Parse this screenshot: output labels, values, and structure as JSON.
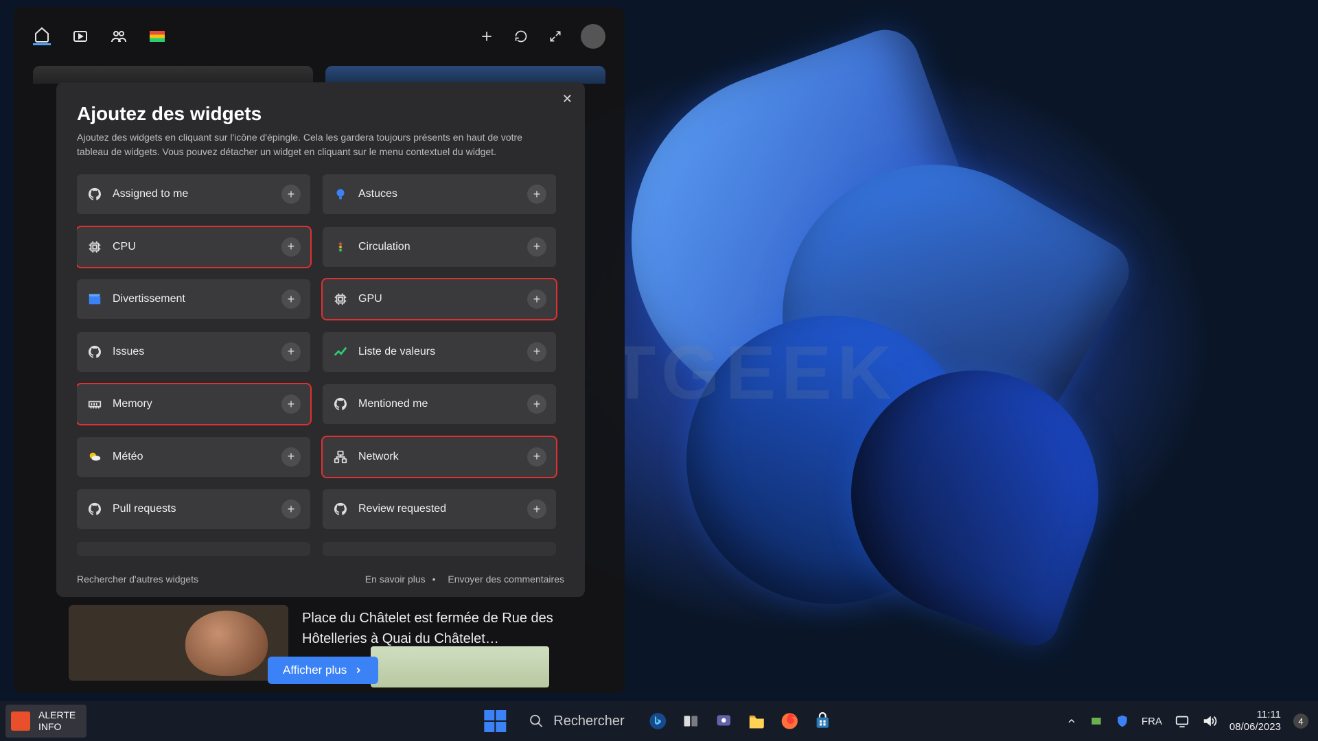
{
  "watermark": "JUSTGEEK",
  "panel": {
    "nav_icons": [
      "home",
      "video",
      "people",
      "flag"
    ]
  },
  "modal": {
    "title": "Ajoutez des widgets",
    "subtitle": "Ajoutez des widgets en cliquant sur l'icône d'épingle. Cela les gardera toujours présents en haut de votre tableau de widgets. Vous pouvez détacher un widget en cliquant sur le menu contextuel du widget.",
    "items": [
      {
        "label": "Assigned to me",
        "icon": "github",
        "hl": false
      },
      {
        "label": "Astuces",
        "icon": "bulb",
        "hl": false
      },
      {
        "label": "CPU",
        "icon": "chip",
        "hl": true
      },
      {
        "label": "Circulation",
        "icon": "traffic",
        "hl": false
      },
      {
        "label": "Divertissement",
        "icon": "clapper",
        "hl": false
      },
      {
        "label": "GPU",
        "icon": "chip",
        "hl": true
      },
      {
        "label": "Issues",
        "icon": "github",
        "hl": false
      },
      {
        "label": "Liste de valeurs",
        "icon": "stocks",
        "hl": false
      },
      {
        "label": "Memory",
        "icon": "ram",
        "hl": true
      },
      {
        "label": "Mentioned me",
        "icon": "github",
        "hl": false
      },
      {
        "label": "Météo",
        "icon": "weather",
        "hl": false
      },
      {
        "label": "Network",
        "icon": "network",
        "hl": true
      },
      {
        "label": "Pull requests",
        "icon": "github",
        "hl": false
      },
      {
        "label": "Review requested",
        "icon": "github",
        "hl": false
      }
    ],
    "footer": {
      "search": "Rechercher d'autres widgets",
      "learn": "En savoir plus",
      "feedback": "Envoyer des commentaires"
    }
  },
  "news": {
    "text": "Place du Châtelet est fermée de Rue des Hôtelleries à Quai du Châtelet…",
    "show_more": "Afficher plus"
  },
  "taskbar": {
    "alert_line1": "ALERTE",
    "alert_line2": "INFO",
    "search_placeholder": "Rechercher",
    "lang": "FRA",
    "time": "11:11",
    "date": "08/06/2023",
    "notif_count": "4"
  }
}
